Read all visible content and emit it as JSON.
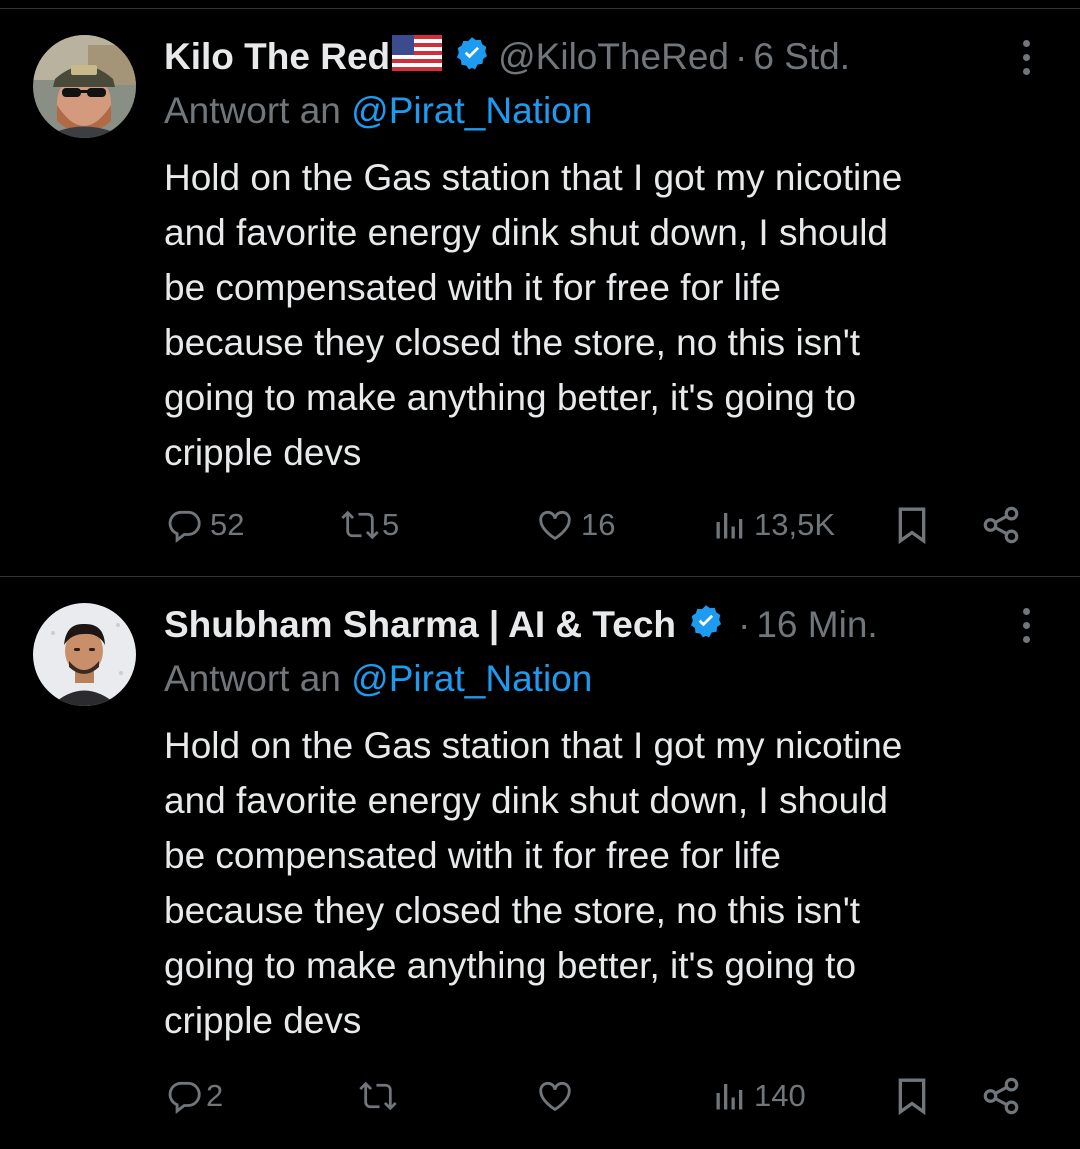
{
  "tweets": [
    {
      "name": "Kilo The Red",
      "flag": "us-flag",
      "verified": true,
      "handle": "@KiloTheRed",
      "separator": "·",
      "time": "6 Std.",
      "reply_prefix": "Antwort an",
      "reply_mention": "@Pirat_Nation",
      "text": "Hold on the Gas station that I got my nicotine\nand favorite energy dink shut down, I should\nbe compensated with it for free for life\nbecause they closed the store, no this isn't\ngoing to make anything better, it's going to\ncripple devs",
      "replies": "52",
      "reposts": "5",
      "likes": "16",
      "views": "13,5K"
    },
    {
      "name": "Shubham Sharma | AI & Tech",
      "verified": true,
      "handle": "",
      "separator": "·",
      "time": "16 Min.",
      "reply_prefix": "Antwort an",
      "reply_mention": "@Pirat_Nation",
      "text": "Hold on the Gas station that I got my nicotine\nand favorite energy dink shut down, I should\nbe compensated with it for free for life\nbecause they closed the store, no this isn't\ngoing to make anything better, it's going to\ncripple devs",
      "replies": "2",
      "reposts": "",
      "likes": "",
      "views": "140"
    }
  ],
  "colors": {
    "background": "#000000",
    "text": "#e7e9ea",
    "muted": "#71767b",
    "accent": "#1d9bf0",
    "divider": "#2f3336"
  },
  "icons": [
    "reply-icon",
    "repost-icon",
    "like-icon",
    "views-icon",
    "bookmark-icon",
    "share-icon",
    "verified-icon",
    "more-icon"
  ]
}
